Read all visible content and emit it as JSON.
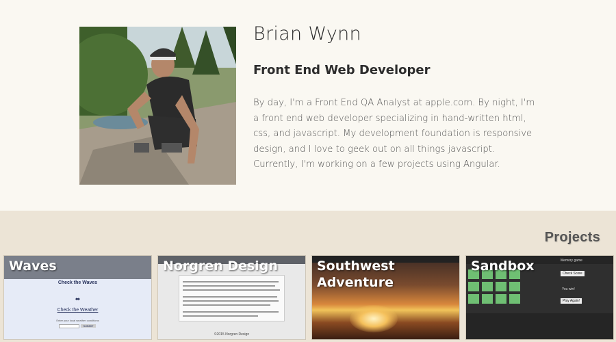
{
  "profile": {
    "name": "Brian Wynn",
    "role": "Front End Web Developer",
    "bio": "By day, I'm a Front End QA Analyst at apple.com. By night, I'm a front end web developer specializing in hand-written html, css, and javascript. My development foundation is responsive design, and I love to geek out on all things javascript. Currently, I'm working on a few projects using Angular."
  },
  "projects": {
    "title": "Projects",
    "items": [
      {
        "label": "Waves"
      },
      {
        "label": "Norgren Design"
      },
      {
        "label": "Southwest Adventure"
      },
      {
        "label": "Sandbox"
      }
    ],
    "waves_thumb": {
      "header": "Check the Waves",
      "link": "Check the Weather",
      "caption": "Enter your local weather conditions",
      "button": "SUBMIT"
    },
    "norgren_thumb": {
      "footer": "©2015 Norgren Design"
    },
    "southwest_thumb": {
      "title": "Southwest Adventure"
    },
    "sandbox_thumb": {
      "title": "Memory game",
      "button1": "Check Score",
      "result": "You win!",
      "button2": "Play Again!"
    }
  },
  "colors": {
    "page_bg": "#faf8f2",
    "projects_bg": "#ece4d6",
    "tile_green": "#6fbf73"
  }
}
